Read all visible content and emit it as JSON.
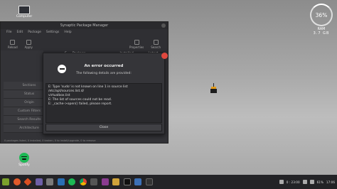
{
  "desktop": {
    "computer_label": "Computer",
    "spotify_label": "Spotify"
  },
  "widget": {
    "percent": "36%",
    "label": "RAM",
    "value": "3.7 GB"
  },
  "synaptic": {
    "title": "Synaptic Package Manager",
    "menu": [
      "File",
      "Edit",
      "Package",
      "Settings",
      "Help"
    ],
    "toolbar": [
      "Reload",
      "Apply"
    ],
    "toolbar_right": [
      "Properties",
      "Search"
    ],
    "columns": [
      "S",
      "Package",
      "Installed Version",
      "Latest Version"
    ],
    "sidebar": [
      "Sections",
      "Status",
      "Origin",
      "Custom Filters",
      "Search Results",
      "Architecture"
    ],
    "status_text": "0 packages listed, 0 installed, 0 broken, 0 to install/upgrade, 0 to remove"
  },
  "dialog": {
    "title": "An error occurred",
    "subtitle": "The following details are provided:",
    "details": [
      "E: Type 'sudo' is not known on line 1 in source list /etc/apt/sources.list.d/",
      "virtualbox.list",
      "E: The list of sources could not be read.",
      "E: _cache->open() failed, please report."
    ],
    "close_label": "Close"
  },
  "taskbar": {
    "tray": [
      "0 : 23:00",
      "61%",
      "17:06"
    ]
  }
}
